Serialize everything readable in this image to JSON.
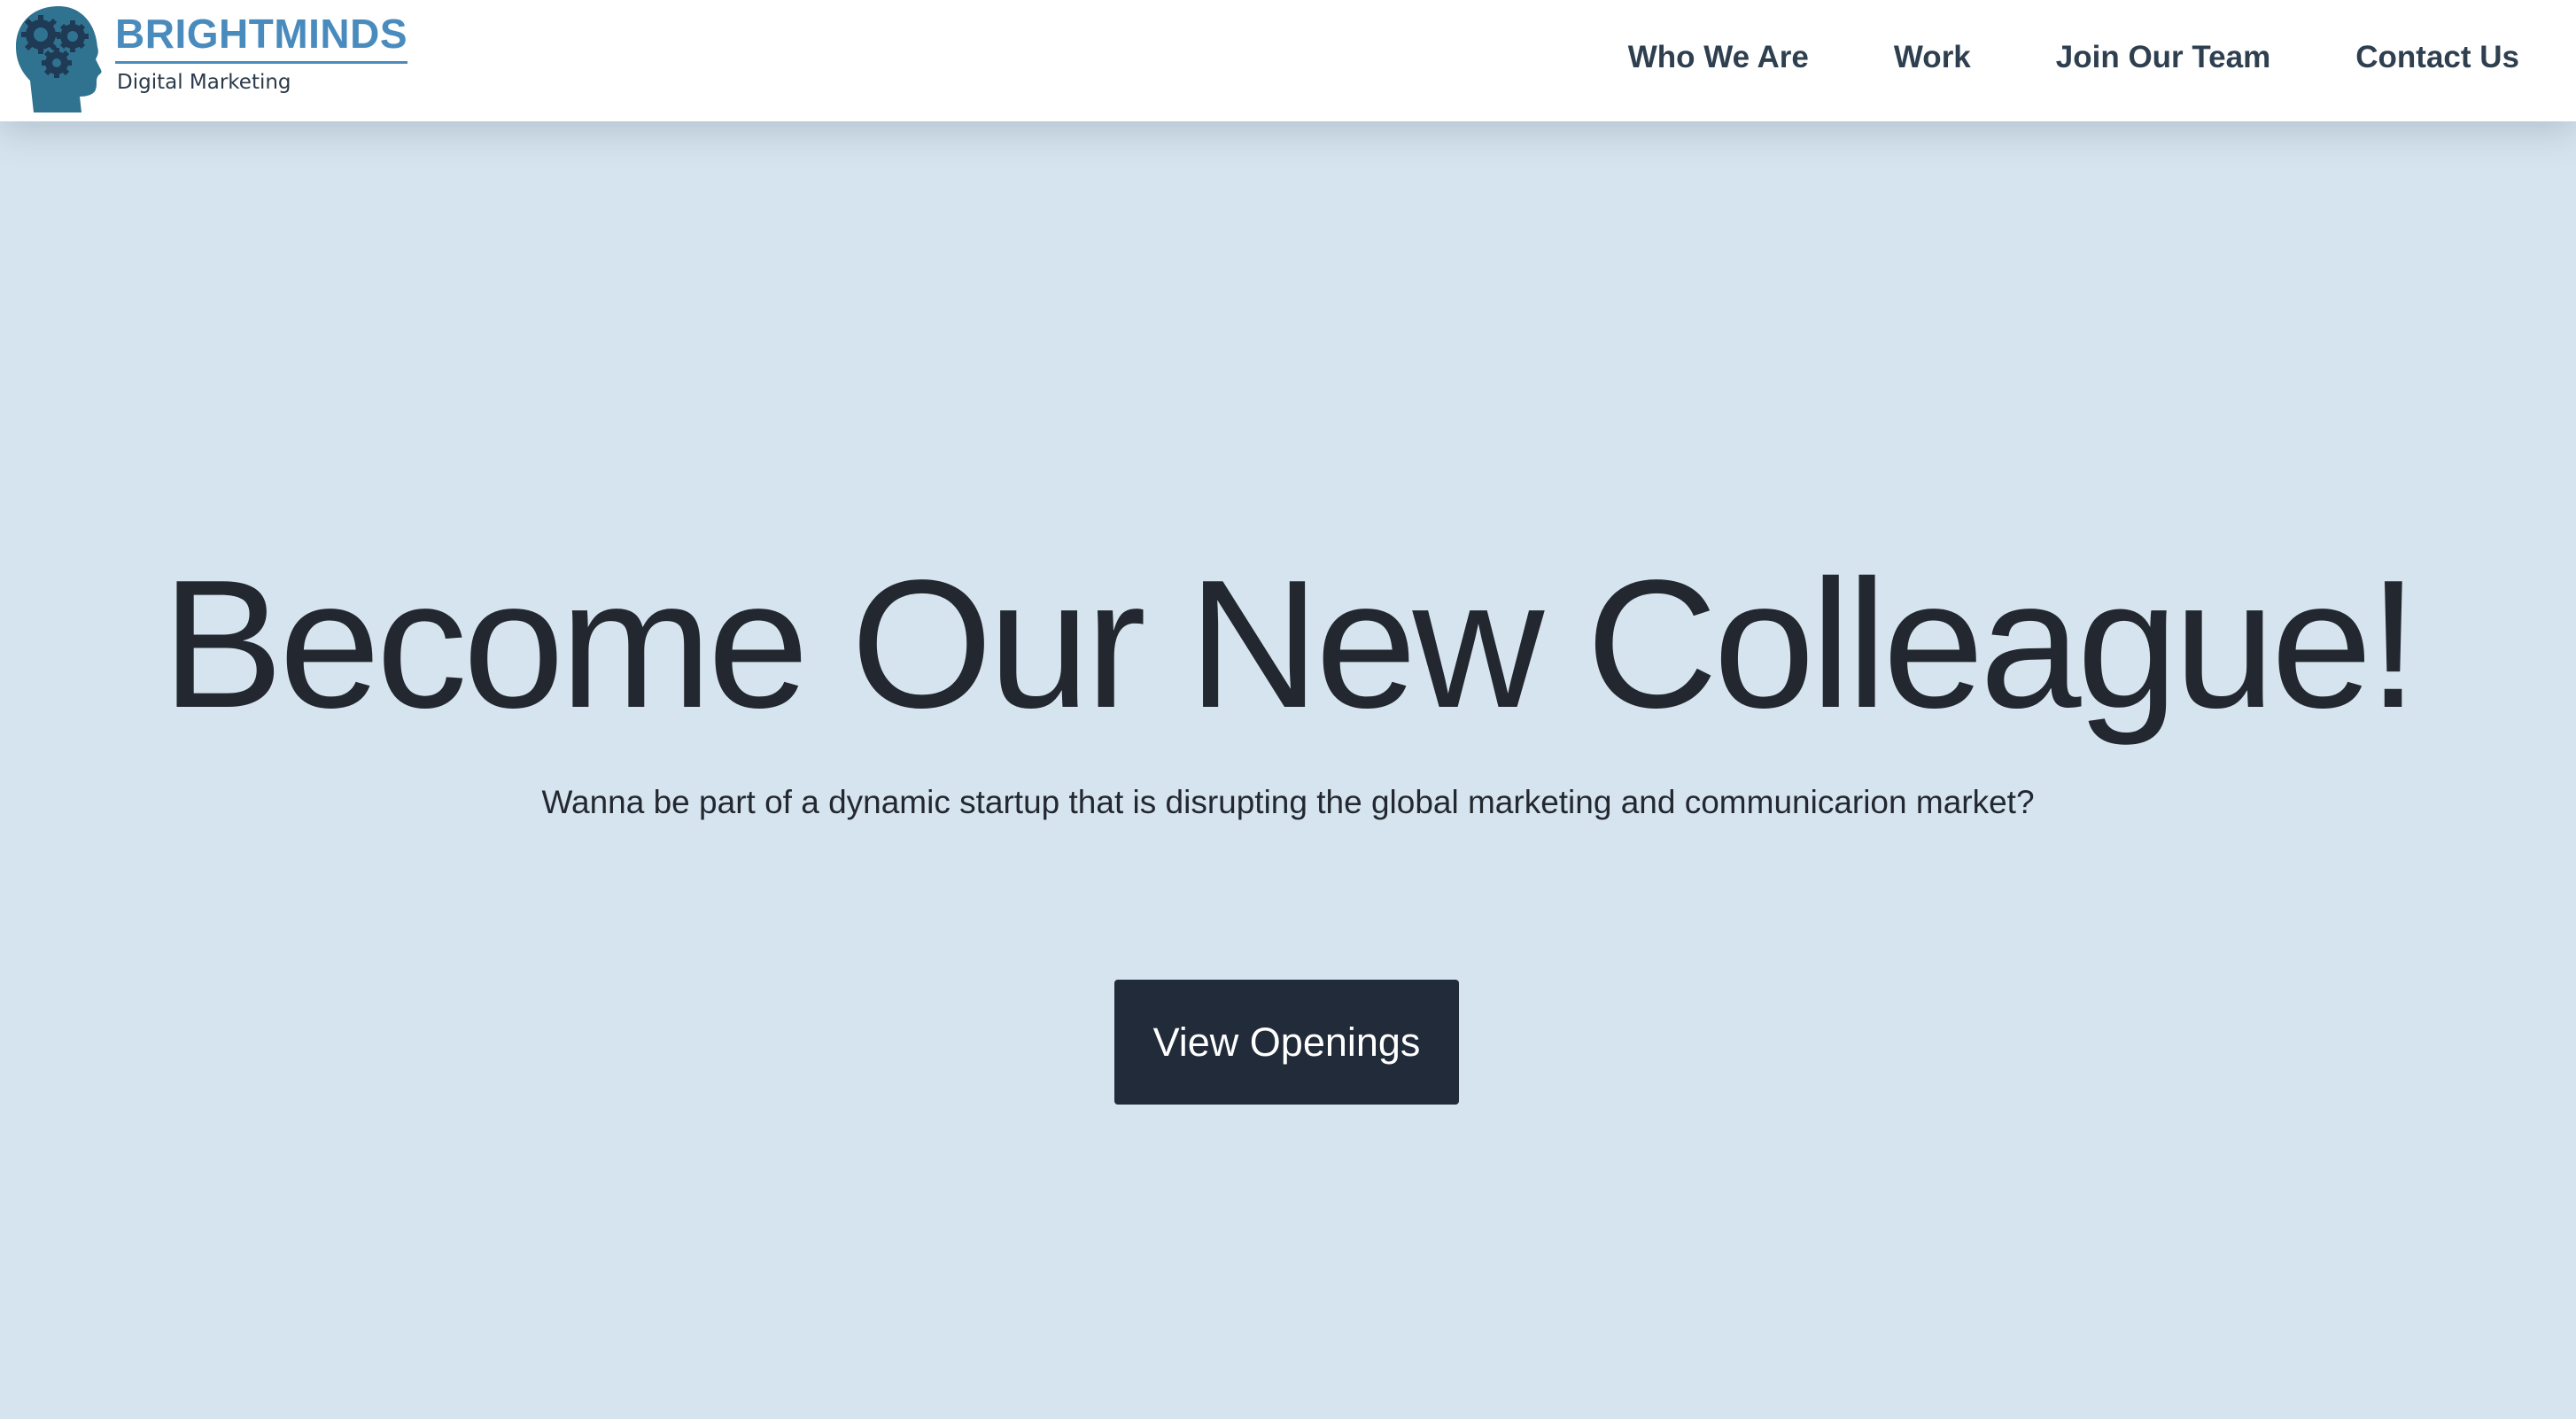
{
  "header": {
    "brand_name": "BRIGHTMINDS",
    "brand_tagline": "Digital Marketing",
    "nav": [
      {
        "label": "Who We Are"
      },
      {
        "label": "Work"
      },
      {
        "label": "Join Our Team"
      },
      {
        "label": "Contact Us"
      }
    ]
  },
  "hero": {
    "title": "Become Our New Colleague!",
    "subtitle": "Wanna be part of a dynamic startup that is disrupting the global marketing and communicarion market?",
    "cta_label": "View Openings"
  },
  "colors": {
    "background": "#d6e4ef",
    "brand_blue": "#4a8bbd",
    "logo_head": "#2f7390",
    "gears": "#1f3a55",
    "text_dark": "#232830",
    "button_bg": "#212b39"
  },
  "icons": {
    "logo_mark": "head-with-gears-icon"
  }
}
